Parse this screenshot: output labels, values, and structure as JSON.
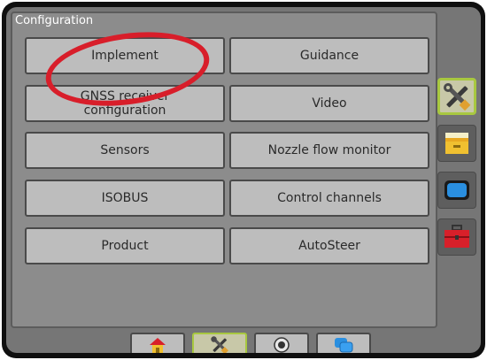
{
  "panel": {
    "title": "Configuration"
  },
  "menu": {
    "implement": "Implement",
    "guidance": "Guidance",
    "gnss_line1": "GNSS receiver",
    "gnss_line2": "configuration",
    "video": "Video",
    "sensors": "Sensors",
    "nozzle_flow": "Nozzle flow monitor",
    "isobus": "ISOBUS",
    "control_channels": "Control channels",
    "product": "Product",
    "autosteer": "AutoSteer"
  },
  "side_tabs": [
    "tools-icon",
    "data-icon",
    "screen-icon",
    "toolbox-icon"
  ],
  "bottom_tabs": [
    "home-icon",
    "tools-icon",
    "camera-icon",
    "screens-icon"
  ],
  "colors": {
    "active_tab_border": "#a8c840",
    "annotation": "#d81e2a",
    "button": "#bdbdbd",
    "panel": "#8c8c8c"
  }
}
